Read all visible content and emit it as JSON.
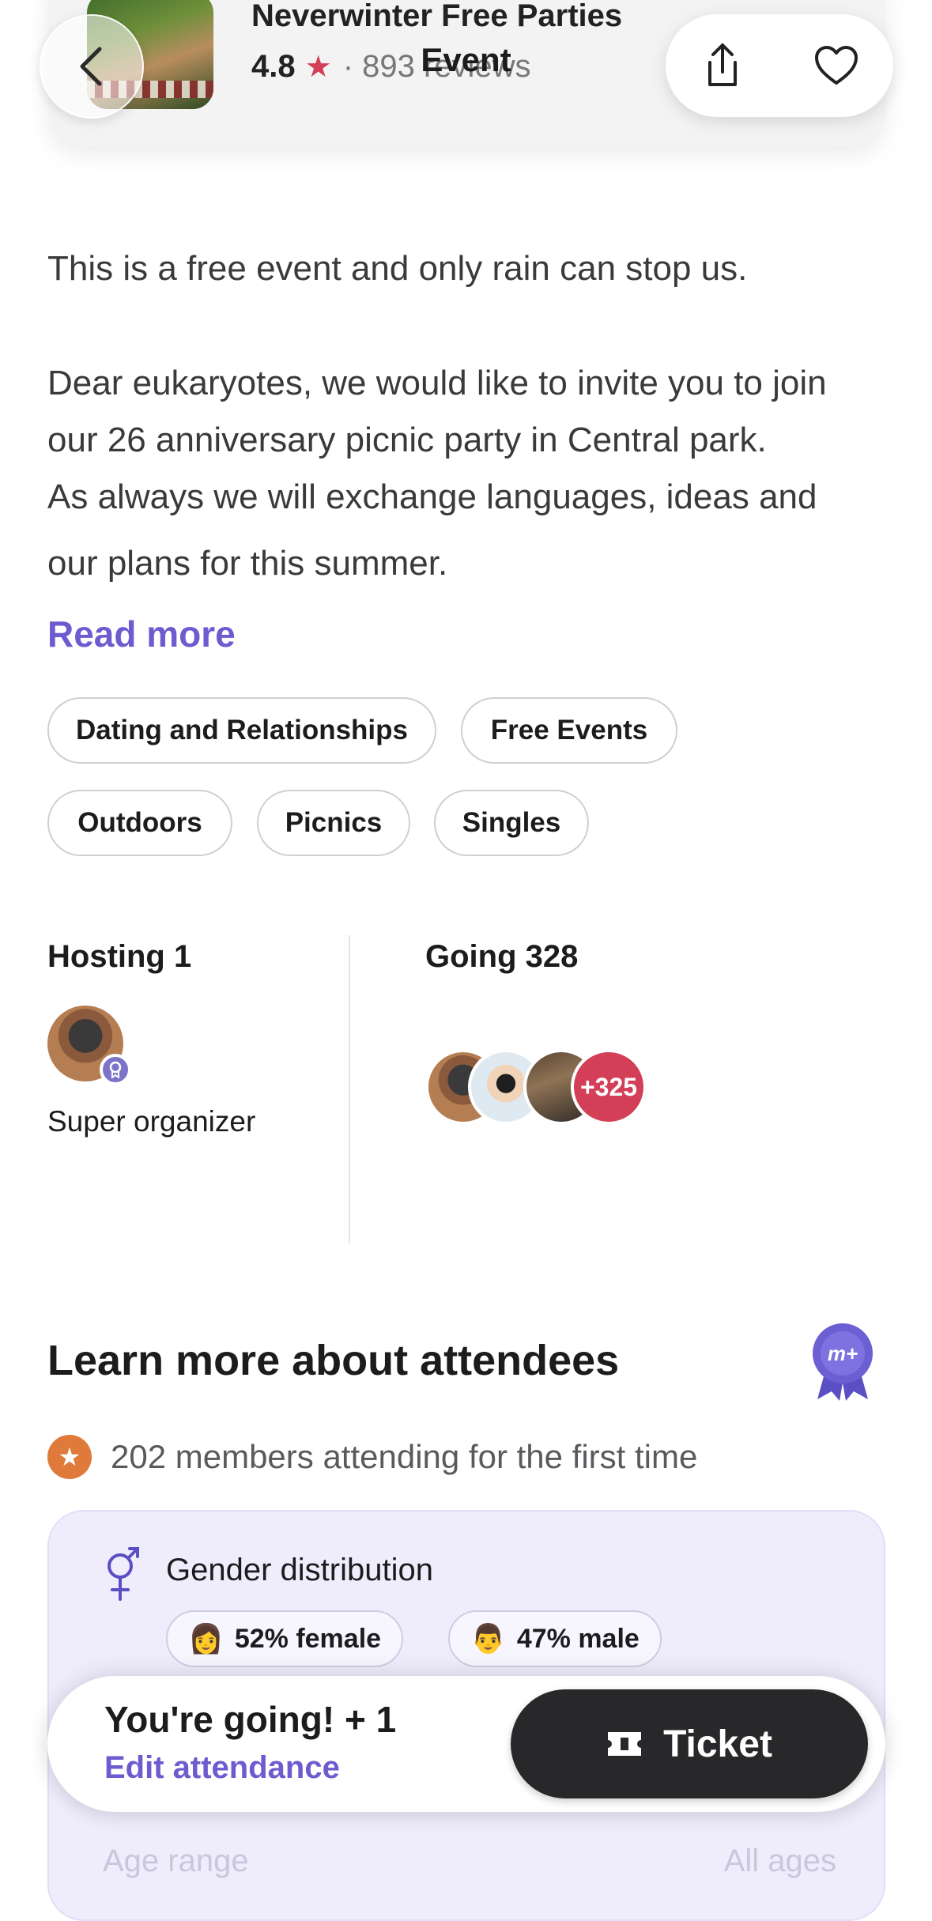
{
  "header": {
    "event_name": "Neverwinter Free Parties",
    "rating": "4.8",
    "reviews": "· 893 reviews",
    "overlay_title": "Event"
  },
  "description": {
    "line1": "This is a free event and only rain can stop us.",
    "para1": "Dear eukaryotes, we would like to invite you to join",
    "para2": "our 26 anniversary picnic party in Central park.",
    "para3": "As always we will exchange languages, ideas and",
    "para4": "our plans for this summer.",
    "read_more": "Read more"
  },
  "tags": [
    "Dating and Relationships",
    "Free Events",
    "Outdoors",
    "Picnics",
    "Singles"
  ],
  "hosting": {
    "label": "Hosting 1",
    "role": "Super organizer"
  },
  "going": {
    "label": "Going 328",
    "more": "+325"
  },
  "attendees": {
    "title": "Learn more about attendees",
    "first_time": "202 members attending for the first time",
    "gender_label": "Gender distribution",
    "female": "52% female",
    "male": "47% male",
    "female_emoji": "👩",
    "male_emoji": "👨",
    "age_label": "Age range",
    "age_value": "All ages"
  },
  "bottom_bar": {
    "status": "You're going! + 1",
    "edit": "Edit attendance",
    "ticket": "Ticket"
  },
  "colors": {
    "accent_purple": "#6c5ccf",
    "star_red": "#d23f57",
    "badge_orange": "#e07a3b",
    "ticket_dark": "#28282a"
  }
}
